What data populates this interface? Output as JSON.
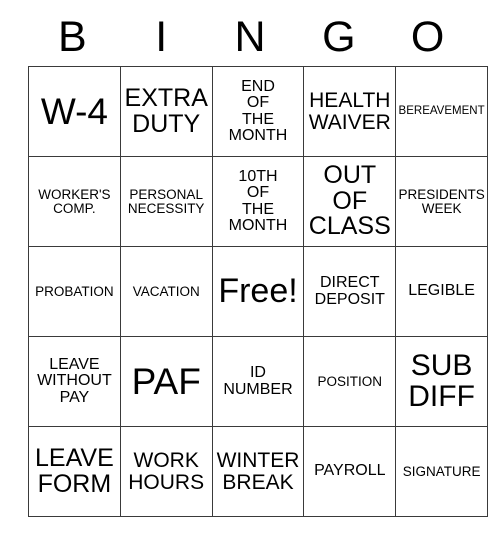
{
  "card": {
    "header_letters": [
      "B",
      "I",
      "N",
      "G",
      "O"
    ],
    "free_space_label": "Free!",
    "rows": [
      [
        {
          "text": "W-4",
          "size": "fs-xxl"
        },
        {
          "text": "EXTRA\nDUTY",
          "size": "fs-lg"
        },
        {
          "text": "END\nOF\nTHE\nMONTH",
          "size": "fs-sm"
        },
        {
          "text": "HEALTH\nWAIVER",
          "size": "fs-md"
        },
        {
          "text": "BEREAVEMENT",
          "size": "fs-xxs"
        }
      ],
      [
        {
          "text": "WORKER'S\nCOMP.",
          "size": "fs-xs"
        },
        {
          "text": "PERSONAL\nNECESSITY",
          "size": "fs-xs"
        },
        {
          "text": "10TH\nOF\nTHE\nMONTH",
          "size": "fs-sm"
        },
        {
          "text": "OUT\nOF\nCLASS",
          "size": "fs-lg"
        },
        {
          "text": "PRESIDENTS\nWEEK",
          "size": "fs-xs"
        }
      ],
      [
        {
          "text": "PROBATION",
          "size": "fs-xs"
        },
        {
          "text": "VACATION",
          "size": "fs-xs"
        },
        {
          "text": "Free!",
          "size": "fs-free",
          "free": true
        },
        {
          "text": "DIRECT\nDEPOSIT",
          "size": "fs-sm"
        },
        {
          "text": "LEGIBLE",
          "size": "fs-sm"
        }
      ],
      [
        {
          "text": "LEAVE\nWITHOUT\nPAY",
          "size": "fs-sm"
        },
        {
          "text": "PAF",
          "size": "fs-xxl"
        },
        {
          "text": "ID\nNUMBER",
          "size": "fs-sm"
        },
        {
          "text": "POSITION",
          "size": "fs-xs"
        },
        {
          "text": "SUB\nDIFF",
          "size": "fs-xl"
        }
      ],
      [
        {
          "text": "LEAVE\nFORM",
          "size": "fs-lg"
        },
        {
          "text": "WORK\nHOURS",
          "size": "fs-md"
        },
        {
          "text": "WINTER\nBREAK",
          "size": "fs-md"
        },
        {
          "text": "PAYROLL",
          "size": "fs-sm"
        },
        {
          "text": "SIGNATURE",
          "size": "fs-xs"
        }
      ]
    ]
  }
}
